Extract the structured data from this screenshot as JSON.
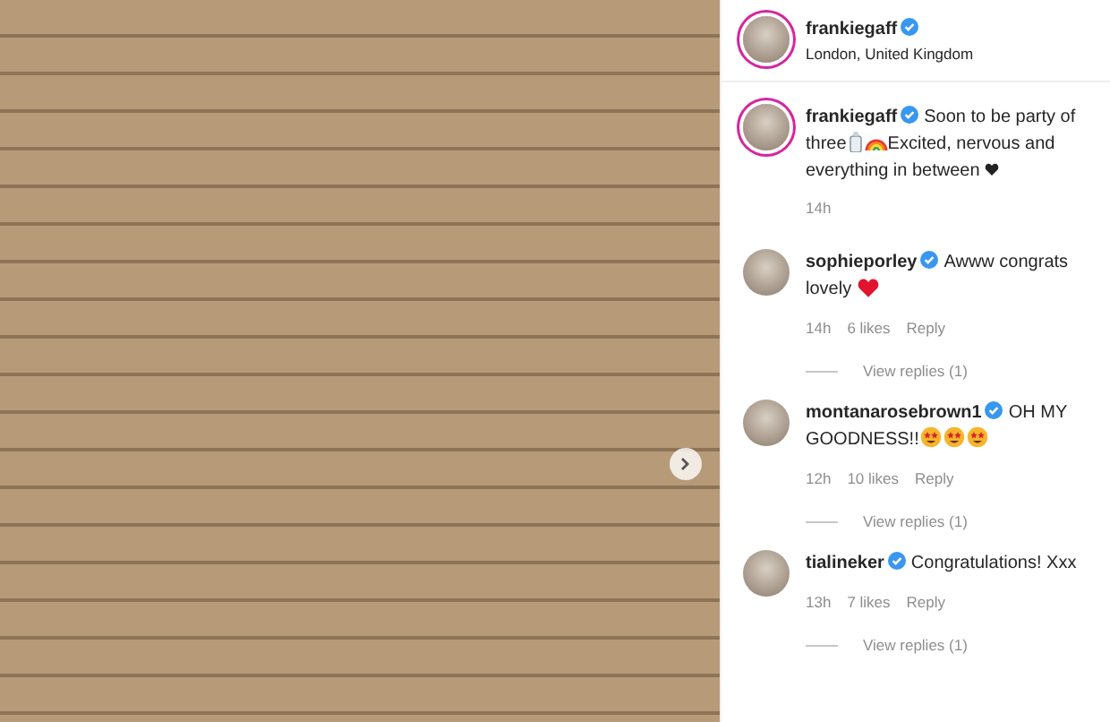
{
  "photo": {
    "next_button": true
  },
  "header": {
    "username": "frankiegaff",
    "verified": true,
    "location": "London, United Kingdom"
  },
  "caption": {
    "username": "frankiegaff",
    "verified": true,
    "parts": [
      {
        "kind": "text",
        "text": "Soon to be party of three"
      },
      {
        "kind": "bottle"
      },
      {
        "kind": "rainbow"
      },
      {
        "kind": "text",
        "text": "Excited, nervous and everything in between"
      },
      {
        "kind": "black-heart"
      }
    ],
    "time": "14h"
  },
  "comments": [
    {
      "username": "sophieporley",
      "verified": true,
      "text": "Awww congrats lovely",
      "emoji": [
        {
          "kind": "red-heart"
        }
      ],
      "time": "14h",
      "likes": "6 likes",
      "reply": "Reply",
      "view_replies": "View replies (1)"
    },
    {
      "username": "montanarosebrown1",
      "verified": true,
      "text": "OH MY GOODNESS!!",
      "emoji": [
        {
          "kind": "star-eyes"
        },
        {
          "kind": "star-eyes"
        },
        {
          "kind": "star-eyes"
        }
      ],
      "time": "12h",
      "likes": "10 likes",
      "reply": "Reply",
      "view_replies": "View replies (1)"
    },
    {
      "username": "tialineker",
      "verified": true,
      "text": "Congratulations! Xxx",
      "time": "13h",
      "likes": "7 likes",
      "reply": "Reply",
      "view_replies": "View replies (1)"
    }
  ]
}
